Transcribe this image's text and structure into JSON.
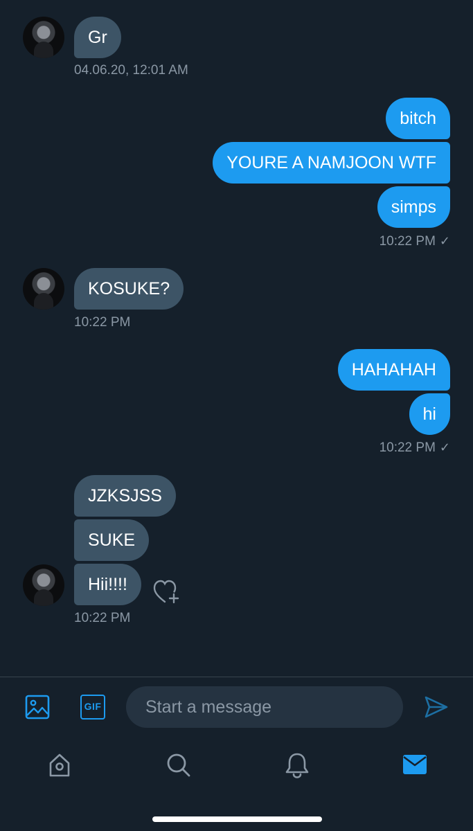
{
  "messages": {
    "m1": {
      "text": "Gr",
      "timestamp": "04.06.20, 12:01 AM"
    },
    "m2": {
      "texts": [
        "bitch",
        "YOURE A NAMJOON WTF",
        "simps"
      ],
      "timestamp": "10:22 PM",
      "check": "✓"
    },
    "m3": {
      "text": "KOSUKE?",
      "timestamp": "10:22 PM"
    },
    "m4": {
      "texts": [
        "HAHAHAH",
        "hi"
      ],
      "timestamp": "10:22 PM",
      "check": "✓"
    },
    "m5": {
      "texts": [
        "JZKSJSS",
        "SUKE",
        "Hii!!!!"
      ],
      "timestamp": "10:22 PM"
    }
  },
  "composer": {
    "placeholder": "Start a message",
    "gif_label": "GIF"
  },
  "icons": {
    "media": "image-icon",
    "gif": "gif-icon",
    "send": "send-icon",
    "react": "heart-add-icon",
    "nav": [
      "home-icon",
      "search-icon",
      "bell-icon",
      "mail-icon"
    ]
  },
  "colors": {
    "background": "#15202b",
    "incoming_bubble": "#3d5466",
    "outgoing_bubble": "#1d9bf0",
    "muted_text": "#8b98a5",
    "accent": "#1d9bf0"
  }
}
